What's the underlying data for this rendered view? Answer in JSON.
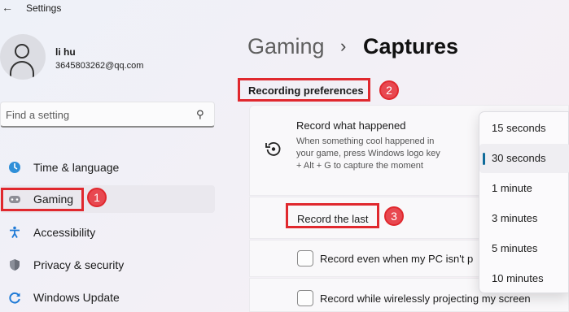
{
  "app": {
    "title": "Settings",
    "back_icon": "back-arrow-icon"
  },
  "user": {
    "name": "li hu",
    "email": "3645803262@qq.com",
    "avatar_icon": "person-icon"
  },
  "search": {
    "placeholder": "Find a setting",
    "icon": "search-icon"
  },
  "sidebar": {
    "items": [
      {
        "label": "Time & language",
        "icon": "globe-clock-icon",
        "active": false
      },
      {
        "label": "Gaming",
        "icon": "gamepad-icon",
        "active": true
      },
      {
        "label": "Accessibility",
        "icon": "accessibility-icon",
        "active": false
      },
      {
        "label": "Privacy & security",
        "icon": "shield-icon",
        "active": false
      },
      {
        "label": "Windows Update",
        "icon": "windows-update-icon",
        "active": false
      }
    ]
  },
  "breadcrumb": {
    "parent": "Gaming",
    "separator": "›",
    "current": "Captures"
  },
  "main": {
    "section_heading": "Recording preferences",
    "record_what_happened": {
      "title": "Record what happened",
      "description": "When something cool happened in your game, press Windows logo key + Alt + G to capture the moment",
      "icon": "replay-icon"
    },
    "record_the_last": {
      "label": "Record the last"
    },
    "checkboxes": [
      {
        "label": "Record even when my PC isn't p",
        "checked": false
      },
      {
        "label": "Record while wirelessly projecting my screen",
        "checked": false
      }
    ]
  },
  "duration_dropdown": {
    "options": [
      "15 seconds",
      "30 seconds",
      "1 minute",
      "3 minutes",
      "5 minutes",
      "10 minutes"
    ],
    "selected": "30 seconds"
  },
  "annotations": {
    "badges": [
      "1",
      "2",
      "3"
    ],
    "highlight_color": "#e0282e"
  },
  "colors": {
    "accent": "#0f6b9a",
    "annotation_red": "#e0282e"
  }
}
